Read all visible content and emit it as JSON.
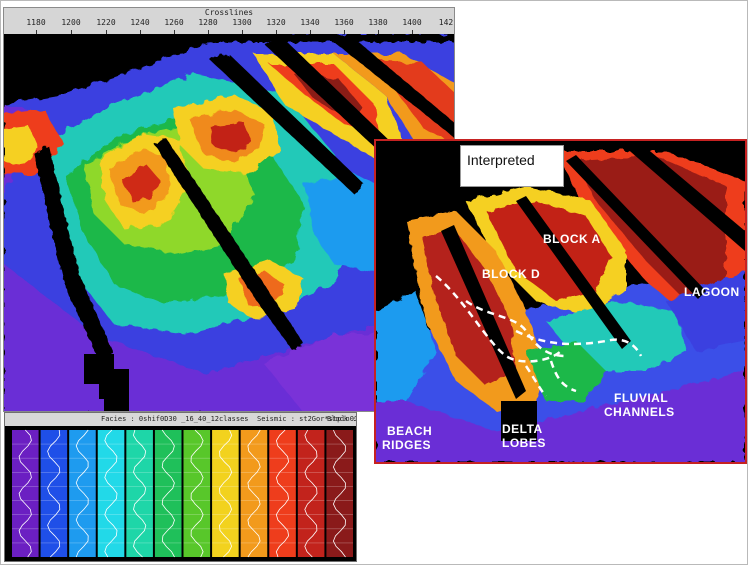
{
  "seismic_panel": {
    "axis_title": "Crosslines",
    "ticks": [
      "1180",
      "1200",
      "1220",
      "1240",
      "1260",
      "1280",
      "1300",
      "1320",
      "1340",
      "1360",
      "1380",
      "1400",
      "142"
    ]
  },
  "interpreted_panel": {
    "title": "Interpreted",
    "labels": {
      "block_a": "BLOCK A",
      "block_d": "BLOCK D",
      "lagoon": "LAGOON",
      "fluvial_1": "FLUVIAL",
      "fluvial_2": "CHANNELS",
      "beach_1": "BEACH",
      "beach_2": "RIDGES",
      "delta_1": "DELTA",
      "delta_2": "LOBES"
    },
    "channel_outline_color": "#ffffff",
    "border_color": "#c62222"
  },
  "legend_panel": {
    "facies": "Facies : 0shif0D30 _16_40_12classes",
    "seismic": "Seismic : st2Gor*stpln01rV",
    "block": "Block : Amplitude",
    "classes": [
      "#6b1fc2",
      "#1f4fe8",
      "#1e9bef",
      "#22d9e8",
      "#1ed6a8",
      "#1fc05a",
      "#58c72a",
      "#f2d21e",
      "#f29a1c",
      "#ee3d1c",
      "#c2231c",
      "#8a1a1a"
    ]
  },
  "palette": {
    "purple": "#6d2fd8",
    "blue": "#2f4fe8",
    "lightblue": "#23a3ef",
    "cyan": "#1ee0e8",
    "teal": "#20d6a0",
    "green": "#1fb84a",
    "lime": "#7fd62a",
    "yellow": "#f5df20",
    "orange": "#f59a1c",
    "red": "#e3331a",
    "darkred": "#9a1d14",
    "black": "#000000"
  }
}
